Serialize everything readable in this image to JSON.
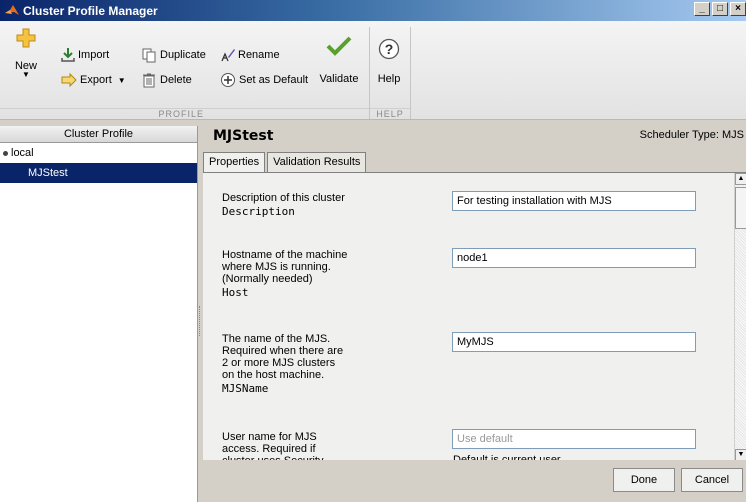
{
  "window": {
    "title": "Cluster Profile Manager"
  },
  "toolstrip": {
    "new_label": "New",
    "import_label": "Import",
    "export_label": "Export",
    "duplicate_label": "Duplicate",
    "delete_label": "Delete",
    "rename_label": "Rename",
    "set_default_label": "Set as Default",
    "validate_label": "Validate",
    "help_label": "Help",
    "section_profile": "PROFILE",
    "section_help": "HELP"
  },
  "sidebar": {
    "header": "Cluster Profile",
    "items": [
      {
        "label": "local",
        "default": true
      },
      {
        "label": "MJStest",
        "selected": true
      }
    ]
  },
  "main": {
    "profile_name": "MJStest",
    "scheduler_type": "Scheduler Type: MJS",
    "tabs": [
      {
        "label": "Properties"
      },
      {
        "label": "Validation Results"
      }
    ],
    "fields": [
      {
        "desc_lines": [
          "Description of this cluster"
        ],
        "prop": "Description",
        "value": "For testing installation with MJS"
      },
      {
        "desc_lines": [
          "Hostname of the machine",
          "where MJS is running.",
          "(Normally needed)"
        ],
        "prop": "Host",
        "value": "node1"
      },
      {
        "desc_lines": [
          "The name of the MJS.",
          "Required when there are",
          "2 or more MJS clusters",
          "on the host machine."
        ],
        "prop": "MJSName",
        "value": "MyMJS"
      },
      {
        "desc_lines": [
          "User name for MJS",
          "access. Required if",
          "cluster uses Security"
        ],
        "placeholder": "Use default",
        "hint": "Default is current user"
      }
    ]
  },
  "buttons": {
    "done": "Done",
    "cancel": "Cancel"
  },
  "colors": {
    "selection": "#0a246a",
    "title_gradient_start": "#0a246a",
    "checkmark": "#5aa02c"
  }
}
